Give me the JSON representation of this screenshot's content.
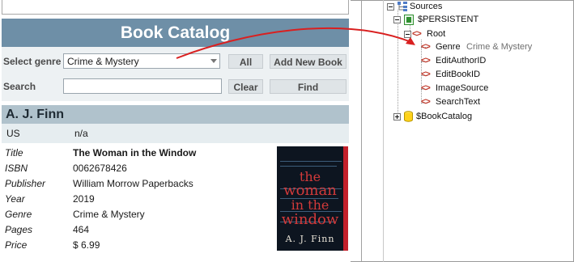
{
  "app": {
    "title": "Book Catalog",
    "select_genre_label": "Select genre",
    "genre_value": "Crime & Mystery",
    "search_label": "Search",
    "search_value": "",
    "buttons": {
      "all": "All",
      "add_new_book": "Add New Book",
      "clear": "Clear",
      "find": "Find"
    },
    "author": "A. J. Finn",
    "country": {
      "code": "US",
      "value": "n/a"
    },
    "details": [
      {
        "label": "Title",
        "value": "The Woman in the Window",
        "bold": true
      },
      {
        "label": "ISBN",
        "value": "0062678426"
      },
      {
        "label": "Publisher",
        "value": "William Morrow Paperbacks"
      },
      {
        "label": "Year",
        "value": "2019"
      },
      {
        "label": "Genre",
        "value": "Crime & Mystery"
      },
      {
        "label": "Pages",
        "value": "464"
      },
      {
        "label": "Price",
        "value": "$ 6.99"
      }
    ],
    "cover": {
      "title_lines": [
        "the",
        "woman",
        "in the",
        "window"
      ],
      "author": "A. J. Finn"
    }
  },
  "tree": {
    "sources": "Sources",
    "persistent": "$PERSISTENT",
    "root": "Root",
    "genre": {
      "name": "Genre",
      "value": "Crime & Mystery"
    },
    "children": [
      "EditAuthorID",
      "EditBookID",
      "ImageSource",
      "SearchText"
    ],
    "bookcatalog": "$BookCatalog"
  },
  "colors": {
    "title_bar": "#6e8fa7",
    "author_bar": "#b0c2cc",
    "arrow": "#d92020",
    "xml_icon": "#c0392b"
  }
}
